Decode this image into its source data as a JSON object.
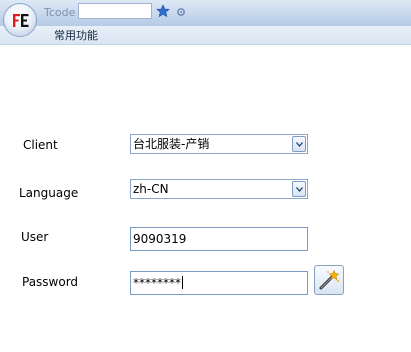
{
  "toolbar": {
    "tcode_label": "Tcode",
    "tcode_value": "",
    "app_logo_text": "FE"
  },
  "menu": {
    "common_functions": "常用功能"
  },
  "form": {
    "client_label": "Client",
    "client_value": "台北服装-产销",
    "language_label": "Language",
    "language_value": "zh-CN",
    "user_label": "User",
    "user_value": "9090319",
    "password_label": "Password",
    "password_value": "********"
  },
  "icons": {
    "favorite": "star-icon",
    "settings": "gear-icon",
    "dropdown": "chevron-down-icon",
    "wizard": "magic-wand-icon"
  },
  "colors": {
    "titlebar": "#c7d8ee",
    "field_border": "#7a9cc4",
    "logo_red": "#e11b1b"
  }
}
